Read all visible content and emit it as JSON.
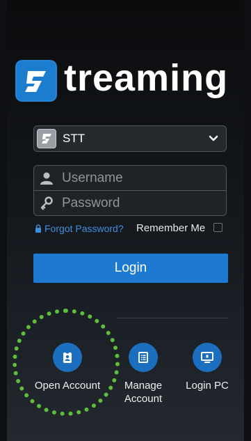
{
  "brand": {
    "logo_text": "treaming",
    "color": "#1b7cd0"
  },
  "server_select": {
    "selected": "STT",
    "icon": "server-logo-icon",
    "chevron": "chevron-down-icon"
  },
  "login_form": {
    "username_placeholder": "Username",
    "password_placeholder": "Password",
    "forgot_password": "Forgot Password?",
    "remember_me": "Remember Me",
    "login_label": "Login"
  },
  "actions": [
    {
      "label": "Open Account",
      "icon": "id-badge-icon"
    },
    {
      "label": "Manage\nAccount",
      "icon": "document-list-icon"
    },
    {
      "label": "Login PC",
      "icon": "monitor-icon"
    }
  ],
  "colors": {
    "accent": "#1e7ad0",
    "highlight": "#5fbf3a",
    "link": "#3f8fe0"
  }
}
